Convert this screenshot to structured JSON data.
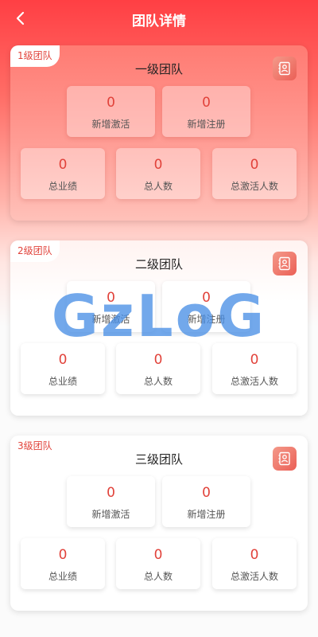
{
  "header": {
    "title": "团队详情",
    "back_icon": "chevron-left-icon"
  },
  "cards": [
    {
      "badge": "1级团队",
      "title": "一级团队",
      "icon": "contact-book-icon",
      "stats": [
        {
          "value": "0",
          "label": "新增激活"
        },
        {
          "value": "0",
          "label": "新增注册"
        },
        {
          "value": "0",
          "label": "总业绩"
        },
        {
          "value": "0",
          "label": "总人数"
        },
        {
          "value": "0",
          "label": "总激活人数"
        }
      ]
    },
    {
      "badge": "2级团队",
      "title": "二级团队",
      "icon": "contact-book-icon",
      "stats": [
        {
          "value": "0",
          "label": "新增激活"
        },
        {
          "value": "0",
          "label": "新增注册"
        },
        {
          "value": "0",
          "label": "总业绩"
        },
        {
          "value": "0",
          "label": "总人数"
        },
        {
          "value": "0",
          "label": "总激活人数"
        }
      ]
    },
    {
      "badge": "3级团队",
      "title": "三级团队",
      "icon": "contact-book-icon",
      "stats": [
        {
          "value": "0",
          "label": "新增激活"
        },
        {
          "value": "0",
          "label": "新增注册"
        },
        {
          "value": "0",
          "label": "总业绩"
        },
        {
          "value": "0",
          "label": "总人数"
        },
        {
          "value": "0",
          "label": "总激活人数"
        }
      ]
    }
  ],
  "watermark": "GzLoG",
  "colors": {
    "accent": "#e1423a",
    "header_red": "#ff3f44",
    "watermark": "#4a90e6"
  }
}
